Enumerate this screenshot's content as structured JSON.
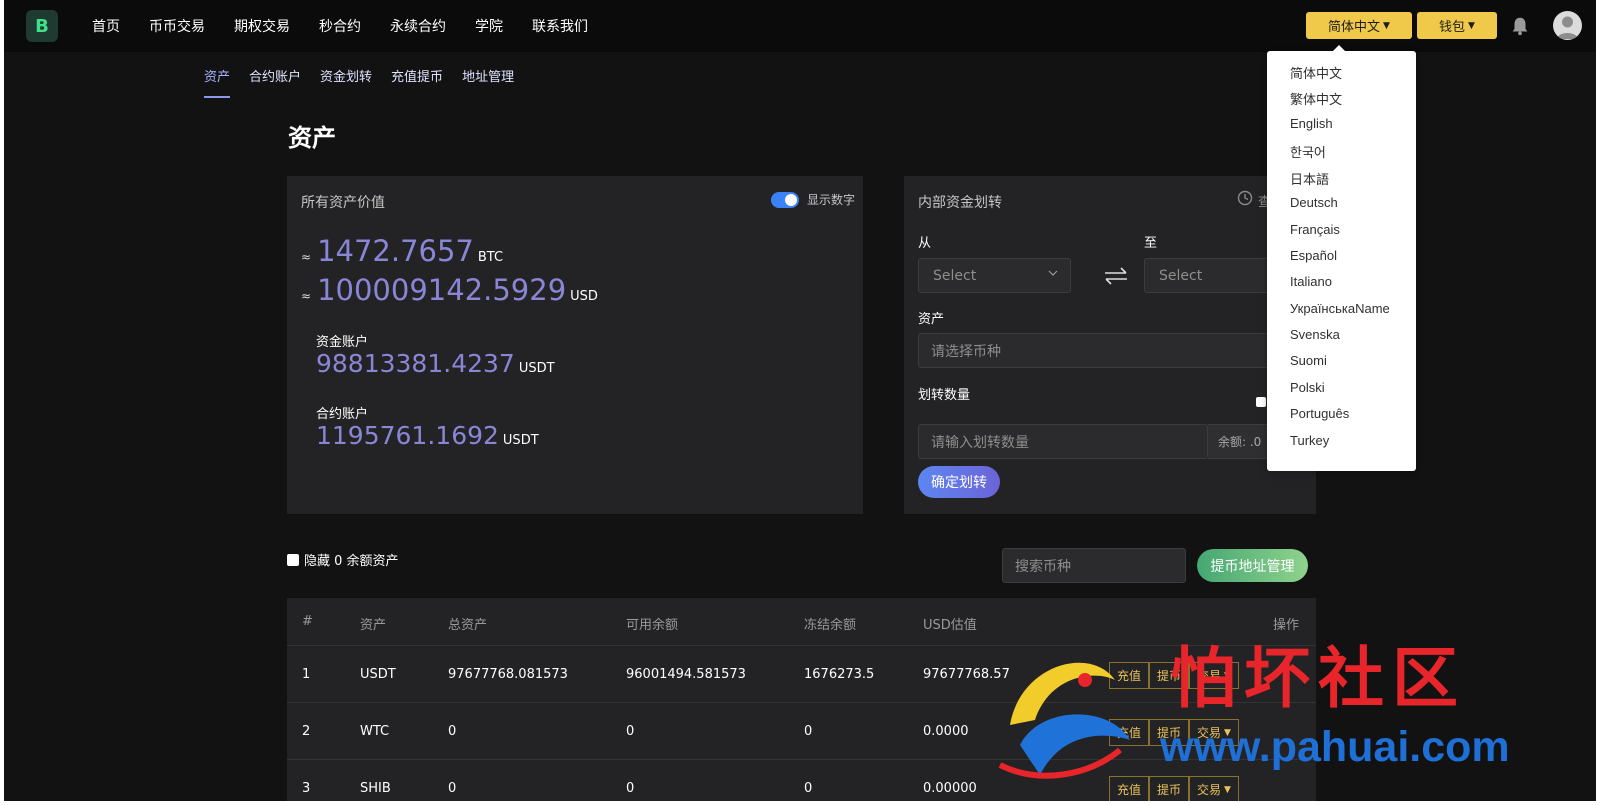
{
  "nav": {
    "logo": "B",
    "items": [
      "首页",
      "币币交易",
      "期权交易",
      "秒合约",
      "永续合约",
      "学院",
      "联系我们"
    ],
    "language_button": "简体中文",
    "wallet_button": "钱包"
  },
  "subtabs": [
    "资产",
    "合约账户",
    "资金划转",
    "充值提币",
    "地址管理"
  ],
  "page_title": "资产",
  "assets_panel": {
    "title": "所有资产价值",
    "toggle_label": "显示数字",
    "toggle_on": true,
    "approx": "≈",
    "btc_value": "1472.7657",
    "btc_unit": "BTC",
    "usd_value": "100009142.5929",
    "usd_unit": "USD",
    "funding_label": "资金账户",
    "funding_value": "98813381.4237",
    "funding_unit": "USDT",
    "contract_label": "合约账户",
    "contract_value": "1195761.1692",
    "contract_unit": "USDT"
  },
  "transfer_panel": {
    "title": "内部资金划转",
    "history_label": "查",
    "from_label": "从",
    "to_label": "至",
    "from_placeholder": "Select",
    "to_placeholder": "Select",
    "asset_label": "资产",
    "asset_placeholder": "请选择币种",
    "amount_label": "划转数量",
    "amount_placeholder": "请输入划转数量",
    "balance_text": "余额: .0",
    "confirm_button": "确定划转"
  },
  "hide_zero_label": "隐藏 0 余额资产",
  "search_placeholder": "搜索币种",
  "address_button": "提币地址管理",
  "table": {
    "headers": [
      "#",
      "资产",
      "总资产",
      "可用余额",
      "冻结余额",
      "USD估值",
      "操作"
    ],
    "rows": [
      {
        "index": "1",
        "asset": "USDT",
        "total": "97677768.081573",
        "available": "96001494.581573",
        "frozen": "1676273.5",
        "usd": "97677768.57"
      },
      {
        "index": "2",
        "asset": "WTC",
        "total": "0",
        "available": "0",
        "frozen": "0",
        "usd": "0.0000"
      },
      {
        "index": "3",
        "asset": "SHIB",
        "total": "0",
        "available": "0",
        "frozen": "0",
        "usd": "0.00000"
      }
    ],
    "actions": {
      "deposit": "充值",
      "withdraw": "提币",
      "trade": "交易"
    }
  },
  "languages": [
    "简体中文",
    "繁体中文",
    "English",
    "한국어",
    "日本語",
    "Deutsch",
    "Français",
    "Español",
    "Italiano",
    "УкраїнськаName",
    "Svenska",
    "Suomi",
    "Polski",
    "Português",
    "Turkey"
  ],
  "watermark": {
    "title": "怕坏社区",
    "url": "www.pahuai.com"
  }
}
